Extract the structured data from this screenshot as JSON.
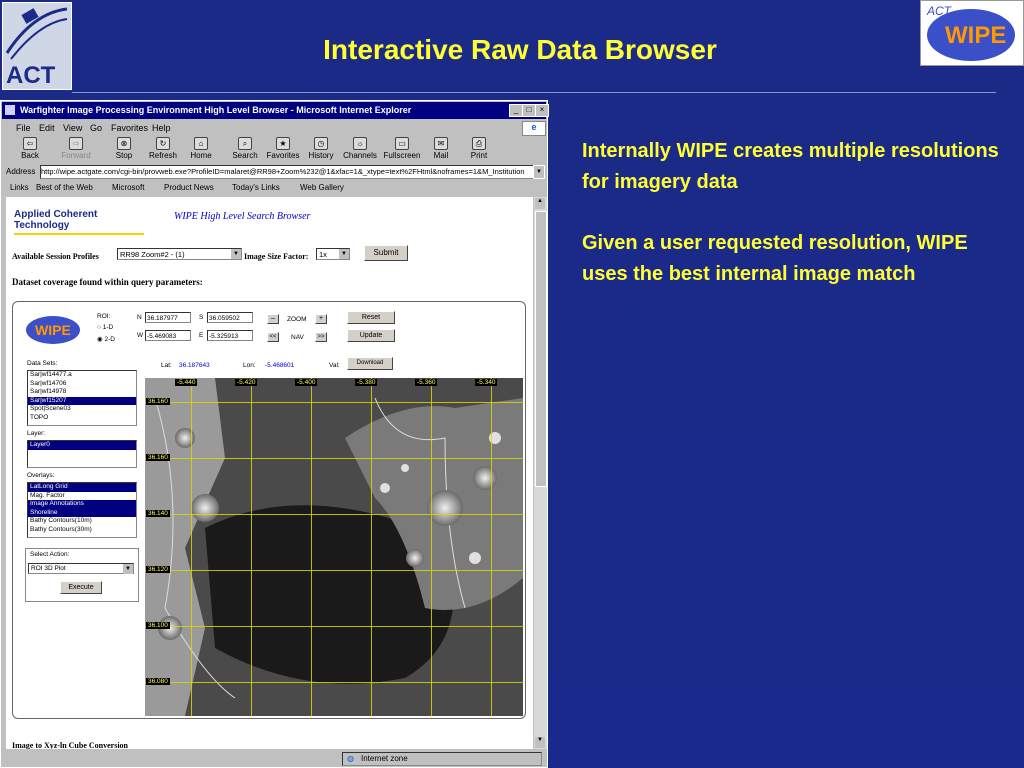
{
  "slide": {
    "title": "Interactive Raw Data Browser",
    "act_logo_text": "ACT",
    "wipe_logo_text": "WIPE",
    "wipe_logo_sub": "ACT",
    "bullets": [
      "Internally WIPE creates multiple resolutions for imagery data",
      "Given a user requested resolution, WIPE uses the best internal image match"
    ]
  },
  "browser": {
    "window_title": "Warfighter Image Processing Environment High Level Browser - Microsoft Internet Explorer",
    "menu": [
      "File",
      "Edit",
      "View",
      "Go",
      "Favorites",
      "Help"
    ],
    "toolbar": [
      {
        "label": "Back",
        "icon": "back-icon"
      },
      {
        "label": "Forward",
        "icon": "forward-icon"
      },
      {
        "label": "Stop",
        "icon": "stop-icon"
      },
      {
        "label": "Refresh",
        "icon": "refresh-icon"
      },
      {
        "label": "Home",
        "icon": "home-icon"
      },
      {
        "label": "Search",
        "icon": "search-icon"
      },
      {
        "label": "Favorites",
        "icon": "favorites-icon"
      },
      {
        "label": "History",
        "icon": "history-icon"
      },
      {
        "label": "Channels",
        "icon": "channels-icon"
      },
      {
        "label": "Fullscreen",
        "icon": "fullscreen-icon"
      },
      {
        "label": "Mail",
        "icon": "mail-icon"
      },
      {
        "label": "Print",
        "icon": "print-icon"
      }
    ],
    "address_label": "Address",
    "address": "http://wipe.actgate.com/cgi-bin/provweb.exe?ProfileID=malaret@RR98+Zoom%232@1&xfac=1&_xtype=text%2FHtml&noframes=1&M_Institution",
    "links_label": "Links",
    "links": [
      "Best of the Web",
      "Microsoft",
      "Product News",
      "Today's Links",
      "Web Gallery"
    ],
    "status_zone": "Internet zone"
  },
  "page": {
    "company_logo": "Applied Coherent Technology",
    "header": "WIPE High Level Search Browser",
    "profiles_label": "Available Session Profiles",
    "profile_value": "RR98 Zoom#2 - (1)",
    "size_factor_label": "Image Size Factor:",
    "size_factor_value": "1x",
    "submit_label": "Submit",
    "coverage_heading": "Dataset coverage found within query parameters:",
    "footer_cut": "Image to Xyz-ln Cube Conversion"
  },
  "controls": {
    "roi_label": "ROI:",
    "roi_options": [
      "1-D",
      "2-D"
    ],
    "n_label": "N",
    "n_value": "36.187977",
    "s_label": "S",
    "s_value": "36.059502",
    "w_label": "W",
    "w_value": "-5.469083",
    "e_label": "E",
    "e_value": "-5.325913",
    "zoom_label": "ZOOM",
    "zoom_minus": "–",
    "zoom_plus": "+",
    "nav_label": "NAV",
    "nav_left": "<<",
    "nav_right": ">>",
    "reset_label": "Reset",
    "update_label": "Update",
    "lat_label": "Lat:",
    "lat_value": "36.187643",
    "lon_label": "Lon:",
    "lon_value": "-5.468601",
    "val_label": "Val:",
    "download_label": "Download",
    "datasets_label": "Data Sets:",
    "datasets": [
      "Sar|wf14477.a",
      "Sar|wf14706",
      "Sar|wf14978",
      "Sar|wf15207",
      "Spot|Scene03",
      "TOPO"
    ],
    "datasets_selected": "Sar|wf15207",
    "layer_label": "Layer:",
    "layers": [
      "Layer0"
    ],
    "overlays_label": "Overlays:",
    "overlays": [
      "LatLong Grid",
      "Mag. Factor",
      "Image Annotations",
      "Shoreline",
      "Bathy Contours(10m)",
      "Bathy Contours(30m)"
    ],
    "select_action_label": "Select Action:",
    "action_value": "ROI 3D Plot",
    "execute_label": "Execute"
  },
  "map": {
    "lon_labels": [
      "-5.440",
      "-5.420",
      "-5.400",
      "-5.380",
      "-5.360",
      "-5.340"
    ],
    "lat_labels": [
      "36.160",
      "36.160",
      "36.140",
      "36.120",
      "36.100",
      "36.080"
    ],
    "grid_color": "#d8d800"
  }
}
